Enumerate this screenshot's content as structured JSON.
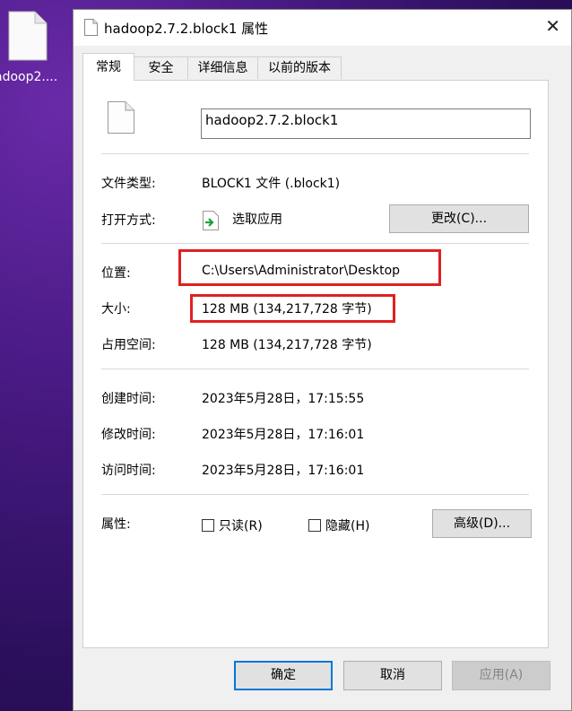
{
  "desktop": {
    "file_label": "adoop2...."
  },
  "dialog": {
    "title": "hadoop2.7.2.block1 属性",
    "close_glyph": "✕",
    "tabs": [
      {
        "label": "常规",
        "active": true
      },
      {
        "label": "安全",
        "active": false
      },
      {
        "label": "详细信息",
        "active": false
      },
      {
        "label": "以前的版本",
        "active": false
      }
    ],
    "general": {
      "file_name": "hadoop2.7.2.block1",
      "type_label": "文件类型:",
      "type_value": "BLOCK1 文件 (.block1)",
      "opens_with_label": "打开方式:",
      "opens_with_value": "选取应用",
      "change_button": "更改(C)...",
      "location_label": "位置:",
      "location_value": "C:\\Users\\Administrator\\Desktop",
      "size_label": "大小:",
      "size_value": "128 MB (134,217,728 字节)",
      "size_on_disk_label": "占用空间:",
      "size_on_disk_value": "128 MB (134,217,728 字节)",
      "created_label": "创建时间:",
      "created_value": "2023年5月28日，17:15:55",
      "modified_label": "修改时间:",
      "modified_value": "2023年5月28日，17:16:01",
      "accessed_label": "访问时间:",
      "accessed_value": "2023年5月28日，17:16:01",
      "attributes_label": "属性:",
      "readonly_label": "只读(R)",
      "readonly_checked": false,
      "hidden_label": "隐藏(H)",
      "hidden_checked": false,
      "advanced_button": "高级(D)..."
    },
    "footer": {
      "ok": "确定",
      "cancel": "取消",
      "apply": "应用(A)"
    }
  },
  "colors": {
    "highlight_box": "#e02020",
    "primary_button_border": "#0078d7"
  }
}
